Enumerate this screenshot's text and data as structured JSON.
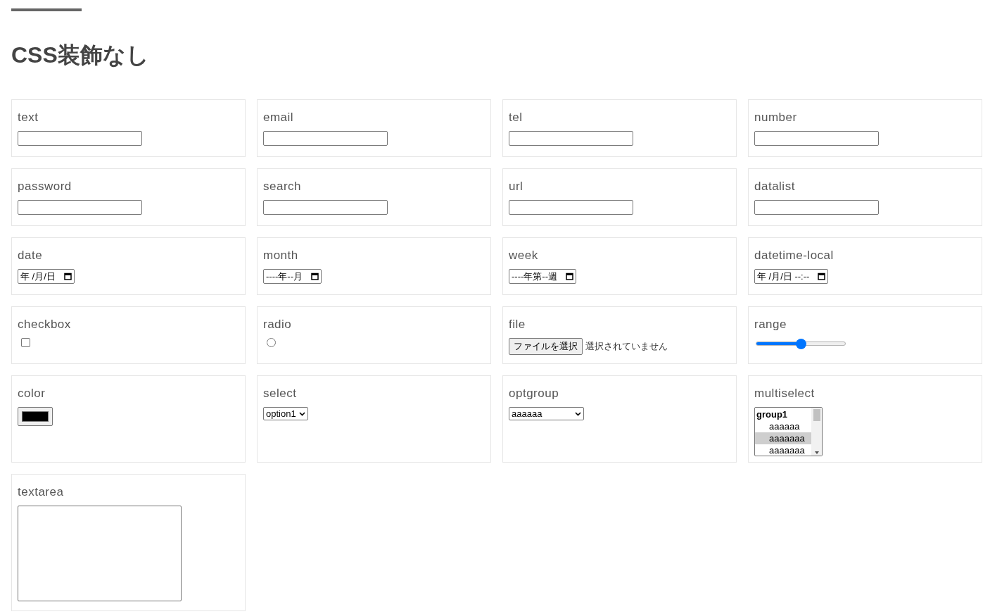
{
  "heading": "CSS装飾なし",
  "fields": [
    {
      "label": "text",
      "kind": "textbox"
    },
    {
      "label": "email",
      "kind": "textbox"
    },
    {
      "label": "tel",
      "kind": "textbox"
    },
    {
      "label": "number",
      "kind": "textbox"
    },
    {
      "label": "password",
      "kind": "textbox"
    },
    {
      "label": "search",
      "kind": "textbox"
    },
    {
      "label": "url",
      "kind": "textbox"
    },
    {
      "label": "datalist",
      "kind": "textbox"
    },
    {
      "label": "date",
      "kind": "datepicker",
      "value": "年 /月/日"
    },
    {
      "label": "month",
      "kind": "datepicker",
      "value": "----年--月"
    },
    {
      "label": "week",
      "kind": "datepicker",
      "value": "----年第--週"
    },
    {
      "label": "datetime-local",
      "kind": "datepicker",
      "value": "年 /月/日 --:--"
    },
    {
      "label": "checkbox",
      "kind": "checkbox",
      "checked": false
    },
    {
      "label": "radio",
      "kind": "radio",
      "selected": false
    },
    {
      "label": "file",
      "kind": "file",
      "button": "ファイルを選択",
      "status": "選択されていません"
    },
    {
      "label": "range",
      "kind": "range",
      "level": 0.5
    },
    {
      "label": "color",
      "kind": "color",
      "color": "#000000"
    },
    {
      "label": "select",
      "kind": "select",
      "value": "option1"
    },
    {
      "label": "optgroup",
      "kind": "select",
      "value": "aaaaaa"
    },
    {
      "label": "multiselect",
      "kind": "multiselect",
      "group": "group1",
      "options": [
        {
          "text": "aaaaaa",
          "selected": false
        },
        {
          "text": "aaaaaaa",
          "selected": true
        },
        {
          "text": "aaaaaaa",
          "selected": false
        }
      ]
    },
    {
      "label": "textarea",
      "kind": "textarea"
    }
  ]
}
